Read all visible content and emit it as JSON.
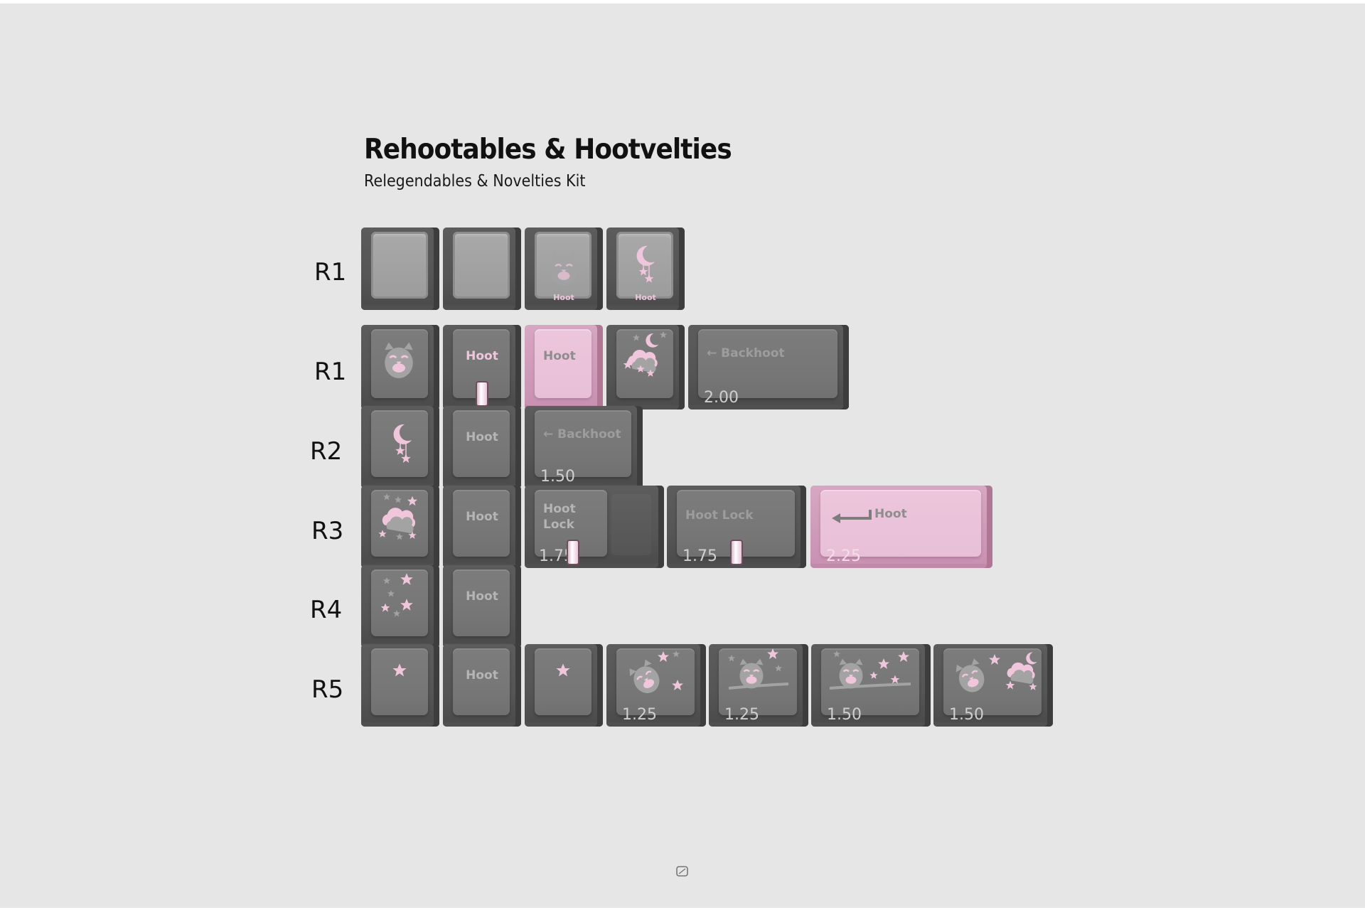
{
  "header": {
    "title": "Rehootables & Hootvelties",
    "subtitle": "Relegendables & Novelties Kit"
  },
  "rows": [
    {
      "label": "R1"
    },
    {
      "label": "R1"
    },
    {
      "label": "R2"
    },
    {
      "label": "R3"
    },
    {
      "label": "R4"
    },
    {
      "label": "R5"
    }
  ],
  "keys": {
    "trans_hoot_label": "Hoot",
    "hoot": "Hoot",
    "backhoot": "Backhoot",
    "backhoot_arrow": "←",
    "hoot_lock_line1": "Hoot",
    "hoot_lock_line2": "Lock",
    "hoot_lock": "Hoot Lock",
    "enter_hoot": "Hoot",
    "size_200": "2.00",
    "size_150": "1.50",
    "size_175": "1.75",
    "size_225": "2.25",
    "size_125": "1.25"
  },
  "colors": {
    "background": "#e6e6e6",
    "key_gray": "#767676",
    "key_pink": "#e8bfd7",
    "legend_pink": "#f0c6dc"
  },
  "icons": [
    "owl-icon",
    "moon-stars-icon",
    "cloud-stars-icon",
    "stars-icon",
    "star-icon",
    "enter-arrow-icon",
    "logo-icon"
  ]
}
